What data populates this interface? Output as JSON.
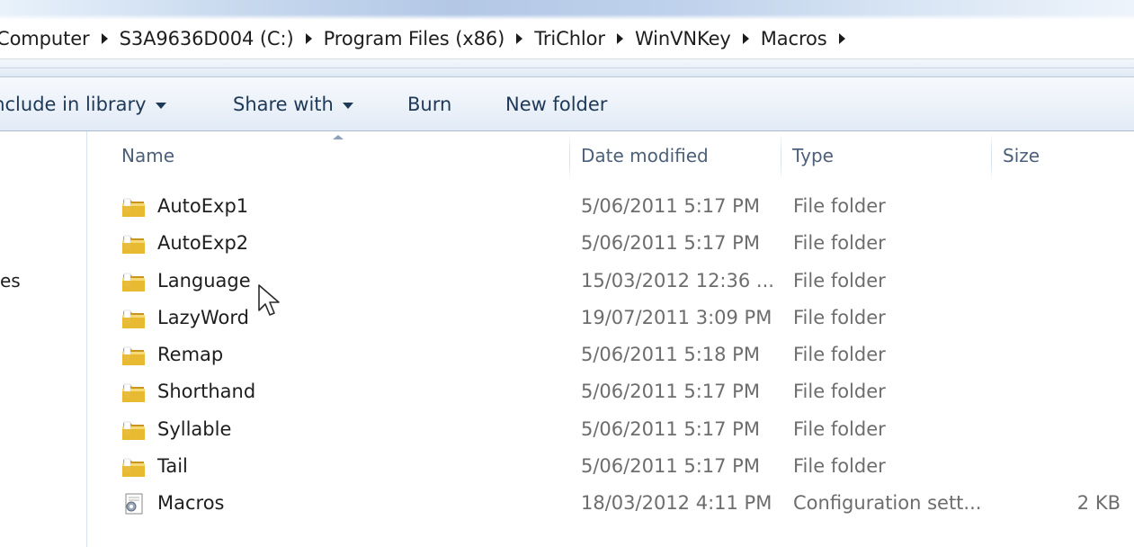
{
  "address_bar": {
    "crumbs": [
      "Computer",
      "S3A9636D004 (C:)",
      "Program Files (x86)",
      "TriChlor",
      "WinVNKey",
      "Macros"
    ]
  },
  "command_bar": {
    "include_in_library": "Include in library",
    "share_with": "Share with",
    "burn": "Burn",
    "new_folder": "New folder"
  },
  "nav_pane": {
    "partial_item": "es"
  },
  "columns": {
    "name": "Name",
    "date_modified": "Date modified",
    "type": "Type",
    "size": "Size"
  },
  "files": [
    {
      "name": "AutoExp1",
      "date": "5/06/2011 5:17 PM",
      "type": "File folder",
      "size": "",
      "icon": "folder-icon"
    },
    {
      "name": "AutoExp2",
      "date": "5/06/2011 5:17 PM",
      "type": "File folder",
      "size": "",
      "icon": "folder-icon"
    },
    {
      "name": "Language",
      "date": "15/03/2012 12:36 ...",
      "type": "File folder",
      "size": "",
      "icon": "folder-icon"
    },
    {
      "name": "LazyWord",
      "date": "19/07/2011 3:09 PM",
      "type": "File folder",
      "size": "",
      "icon": "folder-icon"
    },
    {
      "name": "Remap",
      "date": "5/06/2011 5:18 PM",
      "type": "File folder",
      "size": "",
      "icon": "folder-icon"
    },
    {
      "name": "Shorthand",
      "date": "5/06/2011 5:17 PM",
      "type": "File folder",
      "size": "",
      "icon": "folder-icon"
    },
    {
      "name": "Syllable",
      "date": "5/06/2011 5:17 PM",
      "type": "File folder",
      "size": "",
      "icon": "folder-icon"
    },
    {
      "name": "Tail",
      "date": "5/06/2011 5:17 PM",
      "type": "File folder",
      "size": "",
      "icon": "folder-icon"
    },
    {
      "name": "Macros",
      "date": "18/03/2012 4:11 PM",
      "type": "Configuration sett...",
      "size": "2 KB",
      "icon": "config-settings-icon"
    }
  ],
  "colors": {
    "folder": "#e8b931",
    "command_text": "#1e3958",
    "muted_text": "#6d6d6d"
  }
}
